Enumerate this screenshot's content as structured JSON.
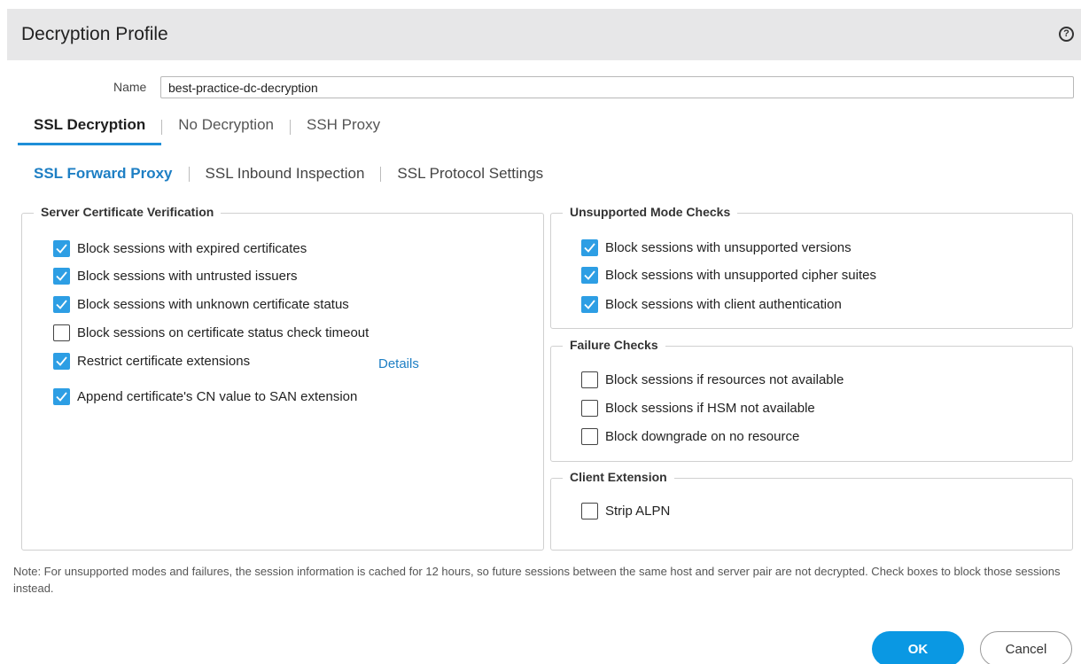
{
  "dialog": {
    "title": "Decryption Profile",
    "help_icon": "question-circle-icon",
    "help_glyph": "?"
  },
  "name_field": {
    "label": "Name",
    "value": "best-practice-dc-decryption"
  },
  "tabs": [
    {
      "label": "SSL Decryption",
      "active": true
    },
    {
      "label": "No Decryption",
      "active": false
    },
    {
      "label": "SSH Proxy",
      "active": false
    }
  ],
  "subtabs": [
    {
      "label": "SSL Forward Proxy",
      "active": true
    },
    {
      "label": "SSL Inbound Inspection",
      "active": false
    },
    {
      "label": "SSL Protocol Settings",
      "active": false
    }
  ],
  "server_cert": {
    "title": "Server Certificate Verification",
    "items": [
      {
        "label": "Block sessions with expired certificates",
        "checked": true
      },
      {
        "label": "Block sessions with untrusted issuers",
        "checked": true
      },
      {
        "label": "Block sessions with unknown certificate status",
        "checked": true
      },
      {
        "label": "Block sessions on certificate status check timeout",
        "checked": false
      },
      {
        "label": "Restrict certificate extensions",
        "checked": true
      },
      {
        "label": "Append certificate's CN value to SAN extension",
        "checked": true
      }
    ],
    "details_label": "Details"
  },
  "unsupported": {
    "title": "Unsupported Mode Checks",
    "items": [
      {
        "label": "Block sessions with unsupported versions",
        "checked": true
      },
      {
        "label": "Block sessions with unsupported cipher suites",
        "checked": true
      },
      {
        "label": "Block sessions with client authentication",
        "checked": true
      }
    ]
  },
  "failure": {
    "title": "Failure Checks",
    "items": [
      {
        "label": "Block sessions if resources not available",
        "checked": false
      },
      {
        "label": "Block sessions if HSM not available",
        "checked": false
      },
      {
        "label": "Block downgrade on no resource",
        "checked": false
      }
    ]
  },
  "client_ext": {
    "title": "Client Extension",
    "items": [
      {
        "label": "Strip ALPN",
        "checked": false
      }
    ]
  },
  "note": "Note: For unsupported modes and failures, the session information is cached for 12 hours, so future sessions between the same host and server pair are not decrypted. Check boxes to block those sessions instead.",
  "buttons": {
    "ok": "OK",
    "cancel": "Cancel"
  },
  "colors": {
    "accent": "#2d9ee4",
    "link": "#1e7fc4",
    "ok_button": "#0a98e3",
    "header_bg": "#e7e7e8"
  }
}
